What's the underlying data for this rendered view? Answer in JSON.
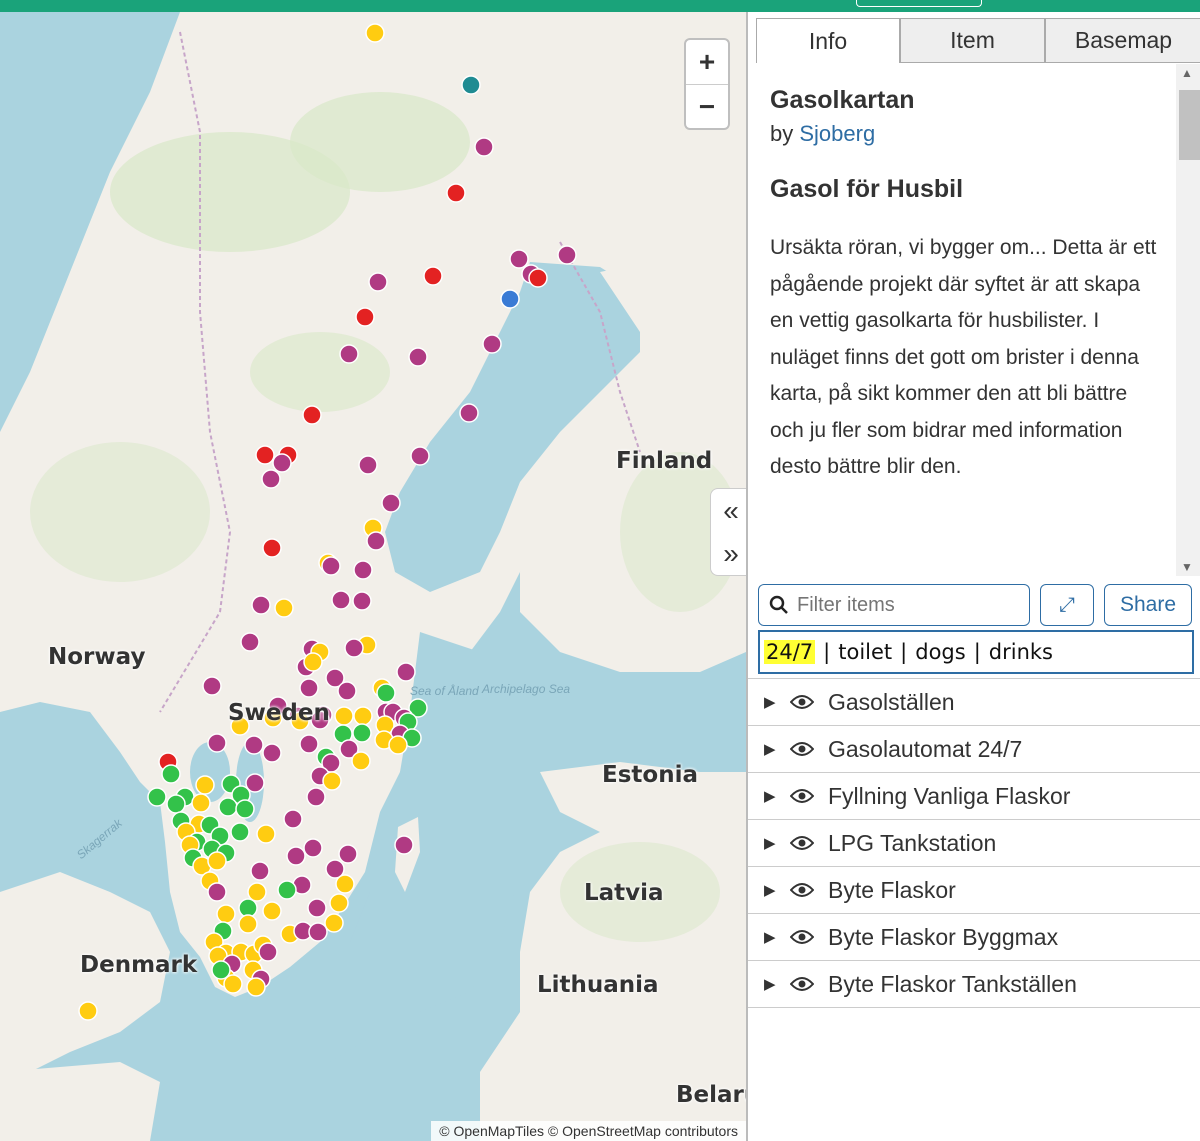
{
  "header": {
    "bar_color": "#1aa37a"
  },
  "map": {
    "zoom_in_label": "+",
    "zoom_out_label": "−",
    "attribution": "© OpenMapTiles © OpenStreetMap contributors",
    "countries": [
      {
        "key": "norway",
        "label": "Norway"
      },
      {
        "key": "sweden",
        "label": "Sweden"
      },
      {
        "key": "finland",
        "label": "Finland"
      },
      {
        "key": "estonia",
        "label": "Estonia"
      },
      {
        "key": "latvia",
        "label": "Latvia"
      },
      {
        "key": "lithuania",
        "label": "Lithuania"
      },
      {
        "key": "denmark",
        "label": "Denmark"
      },
      {
        "key": "belarus",
        "label": "Belarus"
      }
    ],
    "sea_labels": [
      "Skagerrak",
      "Sea of Åland",
      "Archipelago Sea"
    ],
    "marker_colors": {
      "purple": "#b03a83",
      "red": "#e32222",
      "yellow": "#ffcc11",
      "green": "#33c24a",
      "blue": "#3a7bd5",
      "teal": "#1f8b92"
    },
    "collapse_left_icon": "chevron-double-left-icon",
    "collapse_right_icon": "chevron-double-right-icon"
  },
  "panel": {
    "tabs": [
      "Info",
      "Item",
      "Basemap"
    ],
    "active_tab": "Info",
    "title": "Gasolkartan",
    "by_prefix": "by",
    "author": "Sjoberg",
    "subtitle": "Gasol för Husbil",
    "description": "Ursäkta röran, vi bygger om... Detta är ett pågående projekt där syftet är att skapa en vettig gasolkarta för husbilister. I nuläget finns det gott om brister i denna karta, på sikt kommer den att bli bättre och ju fler som bidrar med information desto bättre blir den.",
    "filter_placeholder": "Filter items",
    "share_label": "Share",
    "tags": {
      "highlighted": "24/7",
      "rest": [
        "toilet",
        "dogs",
        "drinks"
      ],
      "separator": "|"
    },
    "layers": [
      "Gasolställen",
      "Gasolautomat 24/7",
      "Fyllning Vanliga Flaskor",
      "LPG Tankstation",
      "Byte Flaskor",
      "Byte Flaskor Byggmax",
      "Byte Flaskor Tankställen"
    ]
  }
}
